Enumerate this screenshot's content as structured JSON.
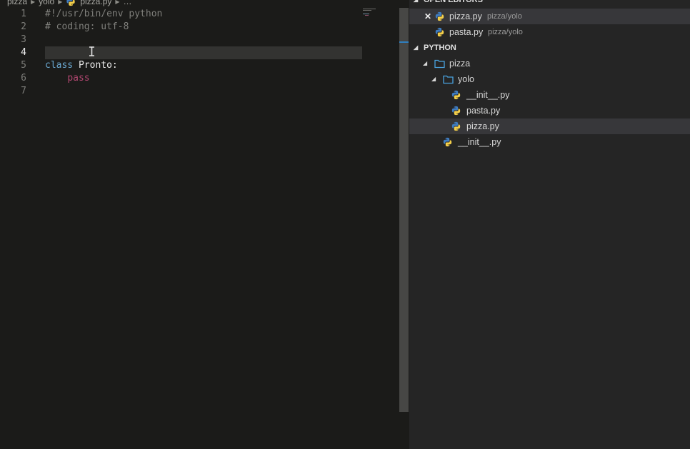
{
  "breadcrumb": {
    "items": [
      "pizza",
      "yolo",
      "pizza.py",
      "…"
    ]
  },
  "editor": {
    "line_numbers": [
      "1",
      "2",
      "3",
      "4",
      "5",
      "6",
      "7"
    ],
    "active_line": "4",
    "lines": {
      "l1": "#!/usr/bin/env python",
      "l2": "# coding: utf-8",
      "l5_keyword": "class",
      "l5_name": " Pronto:",
      "l6_indent": "    ",
      "l6_keyword": "pass"
    }
  },
  "open_editors": {
    "title": "OPEN EDITORS",
    "close_glyph": "✕",
    "items": [
      {
        "name": "pizza.py",
        "path": "pizza/yolo"
      },
      {
        "name": "pasta.py",
        "path": "pizza/yolo"
      }
    ]
  },
  "explorer": {
    "title": "PYTHON",
    "items": [
      {
        "name": "pizza",
        "kind": "folder"
      },
      {
        "name": "yolo",
        "kind": "folder"
      },
      {
        "name": "__init__.py",
        "kind": "python-file"
      },
      {
        "name": "pasta.py",
        "kind": "python-file"
      },
      {
        "name": "pizza.py",
        "kind": "python-file",
        "selected": true
      },
      {
        "name": "__init__.py",
        "kind": "python-file"
      }
    ]
  },
  "colors": {
    "editor_bg": "#1b1b19",
    "sidebar_bg": "#252525",
    "keyword_blue": "#6aa7cf",
    "keyword_pink": "#b0466f",
    "folder_blue": "#4aa3df",
    "python_blue": "#3f7cc0",
    "python_yellow": "#f4cf4a"
  },
  "icons": {
    "file": "python-logo-icon",
    "folder": "folder-outline-icon",
    "expanded": "triangle-down-icon",
    "close": "close-icon",
    "cursor": "text-cursor-icon"
  }
}
